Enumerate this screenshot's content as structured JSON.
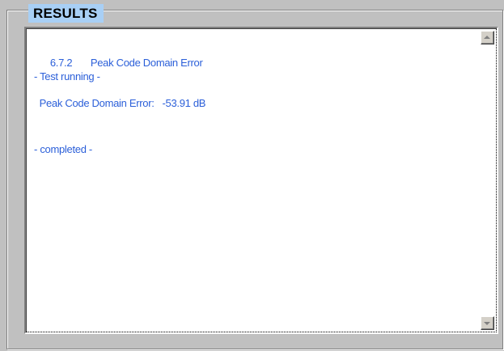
{
  "group": {
    "title": "RESULTS"
  },
  "log": {
    "lines": [
      {
        "number": "6.7.2",
        "text": "Peak Code Domain Error"
      },
      {
        "text": "- Test running -"
      },
      {
        "text": "  Peak Code Domain Error:   -53.91 dB"
      },
      {
        "text": "- completed -"
      }
    ]
  },
  "scrollbar": {
    "up_icon": "arrow-up-icon",
    "down_icon": "arrow-down-icon"
  },
  "colors": {
    "window_bg": "#c0c0c0",
    "title_bg": "#a8cff5",
    "log_text": "#2b5fd9"
  }
}
